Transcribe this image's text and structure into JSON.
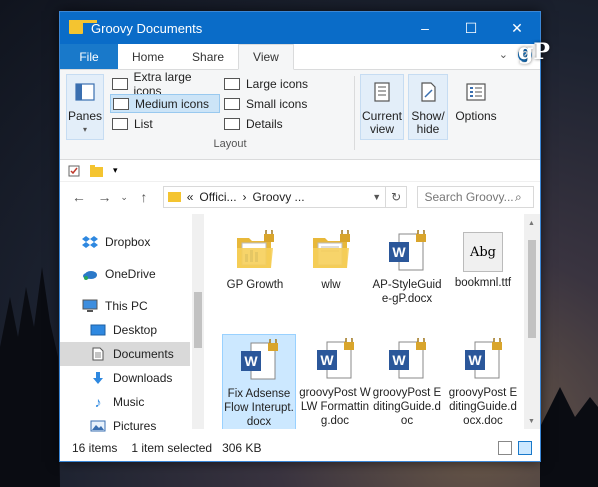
{
  "window": {
    "title": "Groovy Documents",
    "controls": {
      "minimize": "–",
      "maximize": "☐",
      "close": "✕"
    }
  },
  "watermark": {
    "text": "gP"
  },
  "ribbon": {
    "tabs": [
      "File",
      "Home",
      "Share",
      "View"
    ],
    "active_tab": "View",
    "panes": {
      "label": "Panes"
    },
    "layout": {
      "items": [
        "Extra large icons",
        "Large icons",
        "Medium icons",
        "Small icons",
        "List",
        "Details"
      ],
      "selected": "Medium icons",
      "group_label": "Layout"
    },
    "current_view": {
      "line1": "Current",
      "line2": "view"
    },
    "show_hide": {
      "line1": "Show/",
      "line2": "hide"
    },
    "options": {
      "label": "Options"
    }
  },
  "address": {
    "overflow": "«",
    "crumbs": [
      "Offici...",
      "Groovy ..."
    ],
    "separator": "›",
    "search_placeholder": "Search Groovy..."
  },
  "nav_pane": {
    "items": [
      {
        "label": "Dropbox",
        "icon": "dropbox-icon"
      },
      {
        "label": "OneDrive",
        "icon": "onedrive-icon"
      },
      {
        "label": "This PC",
        "icon": "computer-icon"
      },
      {
        "label": "Desktop",
        "icon": "desktop-icon"
      },
      {
        "label": "Documents",
        "icon": "documents-icon"
      },
      {
        "label": "Downloads",
        "icon": "downloads-icon"
      },
      {
        "label": "Music",
        "icon": "music-icon"
      },
      {
        "label": "Pictures",
        "icon": "pictures-icon"
      }
    ],
    "selected": "Documents"
  },
  "files": [
    {
      "name": "GP Growth",
      "type": "folder"
    },
    {
      "name": "wlw",
      "type": "folder"
    },
    {
      "name": "AP-StyleGuide-gP.docx",
      "type": "word"
    },
    {
      "name": "bookmnl.ttf",
      "type": "font",
      "preview": "Abg"
    },
    {
      "name": "Fix Adsense Flow Interupt.docx",
      "type": "word",
      "selected": true
    },
    {
      "name": "groovyPost WLW Formatting.doc",
      "type": "word"
    },
    {
      "name": "groovyPost EditingGuide.doc",
      "type": "word"
    },
    {
      "name": "groovyPost EditingGuide.docx.doc",
      "type": "word"
    }
  ],
  "status": {
    "item_count": "16 items",
    "selection": "1 item selected",
    "size": "306 KB"
  },
  "colors": {
    "titlebar": "#0a6cc8",
    "file_tab": "#1979ca",
    "folder": "#f4c430",
    "word": "#2b579a",
    "selection": "#cce8ff"
  }
}
